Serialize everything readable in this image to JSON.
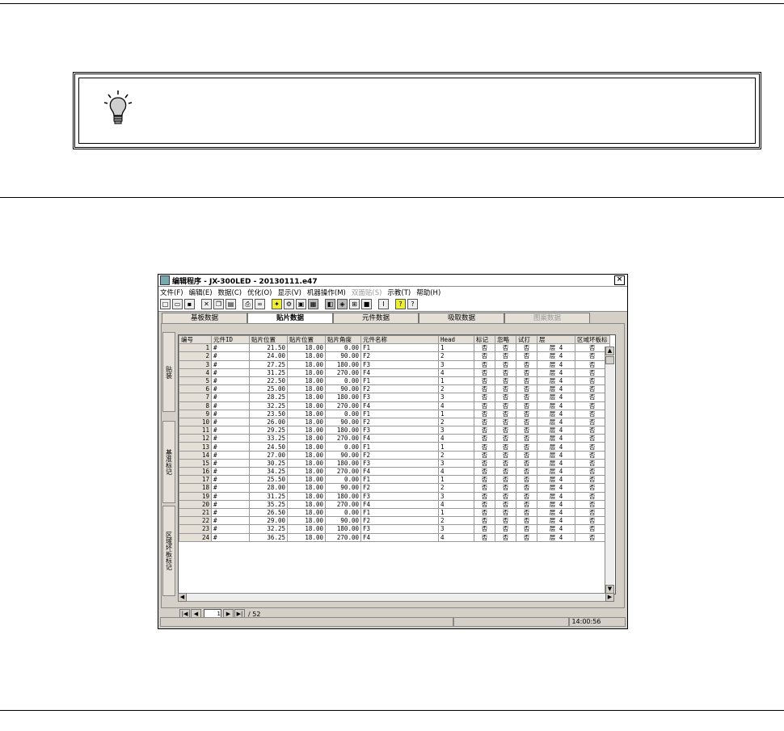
{
  "window": {
    "title": "编辑程序 - JX-300LED - 20130111.e47",
    "close": "×"
  },
  "menu": [
    {
      "label": "文件(F)",
      "disabled": false
    },
    {
      "label": "编辑(E)",
      "disabled": false
    },
    {
      "label": "数据(C)",
      "disabled": false
    },
    {
      "label": "优化(O)",
      "disabled": false
    },
    {
      "label": "显示(V)",
      "disabled": false
    },
    {
      "label": "机器操作(M)",
      "disabled": false
    },
    {
      "label": "双面贴(S)",
      "disabled": true
    },
    {
      "label": "示教(T)",
      "disabled": false
    },
    {
      "label": "帮助(H)",
      "disabled": false
    }
  ],
  "toolbar_icons": [
    "new-icon",
    "open-icon",
    "save-icon",
    "cut-icon",
    "copy-icon",
    "paste-icon",
    "print-icon",
    "find-icon",
    "optimize-icon",
    "settings-icon",
    "component-icon",
    "board-icon",
    "head-icon",
    "nozzle-icon",
    "teach-icon",
    "stop-icon",
    "text-icon",
    "help-icon",
    "context-help-icon"
  ],
  "tabs": [
    {
      "label": "基板数据",
      "active": false,
      "disabled": false
    },
    {
      "label": "贴片数据",
      "active": true,
      "disabled": false
    },
    {
      "label": "元件数据",
      "active": false,
      "disabled": false
    },
    {
      "label": "吸取数据",
      "active": false,
      "disabled": false
    },
    {
      "label": "图案数据",
      "active": false,
      "disabled": true
    }
  ],
  "side_tabs": [
    "贴装",
    "基准标记",
    "区域坏板标记"
  ],
  "columns": [
    "编号",
    "元件ID",
    "贴片位置",
    "贴片位置",
    "贴片角度",
    "元件名称",
    "Head",
    "标记",
    "忽略",
    "试打",
    "层",
    "区域坏板标"
  ],
  "rows": [
    [
      "1",
      "#",
      "21.50",
      "18.00",
      "0.00",
      "F1",
      "1",
      "否",
      "否",
      "否",
      "层 4",
      "否"
    ],
    [
      "2",
      "#",
      "24.00",
      "18.00",
      "90.00",
      "F2",
      "2",
      "否",
      "否",
      "否",
      "层 4",
      "否"
    ],
    [
      "3",
      "#",
      "27.25",
      "18.00",
      "180.00",
      "F3",
      "3",
      "否",
      "否",
      "否",
      "层 4",
      "否"
    ],
    [
      "4",
      "#",
      "31.25",
      "18.00",
      "270.00",
      "F4",
      "4",
      "否",
      "否",
      "否",
      "层 4",
      "否"
    ],
    [
      "5",
      "#",
      "22.50",
      "18.00",
      "0.00",
      "F1",
      "1",
      "否",
      "否",
      "否",
      "层 4",
      "否"
    ],
    [
      "6",
      "#",
      "25.00",
      "18.00",
      "90.00",
      "F2",
      "2",
      "否",
      "否",
      "否",
      "层 4",
      "否"
    ],
    [
      "7",
      "#",
      "28.25",
      "18.00",
      "180.00",
      "F3",
      "3",
      "否",
      "否",
      "否",
      "层 4",
      "否"
    ],
    [
      "8",
      "#",
      "32.25",
      "18.00",
      "270.00",
      "F4",
      "4",
      "否",
      "否",
      "否",
      "层 4",
      "否"
    ],
    [
      "9",
      "#",
      "23.50",
      "18.00",
      "0.00",
      "F1",
      "1",
      "否",
      "否",
      "否",
      "层 4",
      "否"
    ],
    [
      "10",
      "#",
      "26.00",
      "18.00",
      "90.00",
      "F2",
      "2",
      "否",
      "否",
      "否",
      "层 4",
      "否"
    ],
    [
      "11",
      "#",
      "29.25",
      "18.00",
      "180.00",
      "F3",
      "3",
      "否",
      "否",
      "否",
      "层 4",
      "否"
    ],
    [
      "12",
      "#",
      "33.25",
      "18.00",
      "270.00",
      "F4",
      "4",
      "否",
      "否",
      "否",
      "层 4",
      "否"
    ],
    [
      "13",
      "#",
      "24.50",
      "18.00",
      "0.00",
      "F1",
      "1",
      "否",
      "否",
      "否",
      "层 4",
      "否"
    ],
    [
      "14",
      "#",
      "27.00",
      "18.00",
      "90.00",
      "F2",
      "2",
      "否",
      "否",
      "否",
      "层 4",
      "否"
    ],
    [
      "15",
      "#",
      "30.25",
      "18.00",
      "180.00",
      "F3",
      "3",
      "否",
      "否",
      "否",
      "层 4",
      "否"
    ],
    [
      "16",
      "#",
      "34.25",
      "18.00",
      "270.00",
      "F4",
      "4",
      "否",
      "否",
      "否",
      "层 4",
      "否"
    ],
    [
      "17",
      "#",
      "25.50",
      "18.00",
      "0.00",
      "F1",
      "1",
      "否",
      "否",
      "否",
      "层 4",
      "否"
    ],
    [
      "18",
      "#",
      "28.00",
      "18.00",
      "90.00",
      "F2",
      "2",
      "否",
      "否",
      "否",
      "层 4",
      "否"
    ],
    [
      "19",
      "#",
      "31.25",
      "18.00",
      "180.00",
      "F3",
      "3",
      "否",
      "否",
      "否",
      "层 4",
      "否"
    ],
    [
      "20",
      "#",
      "35.25",
      "18.00",
      "270.00",
      "F4",
      "4",
      "否",
      "否",
      "否",
      "层 4",
      "否"
    ],
    [
      "21",
      "#",
      "26.50",
      "18.00",
      "0.00",
      "F1",
      "1",
      "否",
      "否",
      "否",
      "层 4",
      "否"
    ],
    [
      "22",
      "#",
      "29.00",
      "18.00",
      "90.00",
      "F2",
      "2",
      "否",
      "否",
      "否",
      "层 4",
      "否"
    ],
    [
      "23",
      "#",
      "32.25",
      "18.00",
      "180.00",
      "F3",
      "3",
      "否",
      "否",
      "否",
      "层 4",
      "否"
    ],
    [
      "24",
      "#",
      "36.25",
      "18.00",
      "270.00",
      "F4",
      "4",
      "否",
      "否",
      "否",
      "层 4",
      "否"
    ]
  ],
  "pager": {
    "current": "1",
    "total": "/ 52"
  },
  "status": {
    "time": "14:00:56"
  }
}
